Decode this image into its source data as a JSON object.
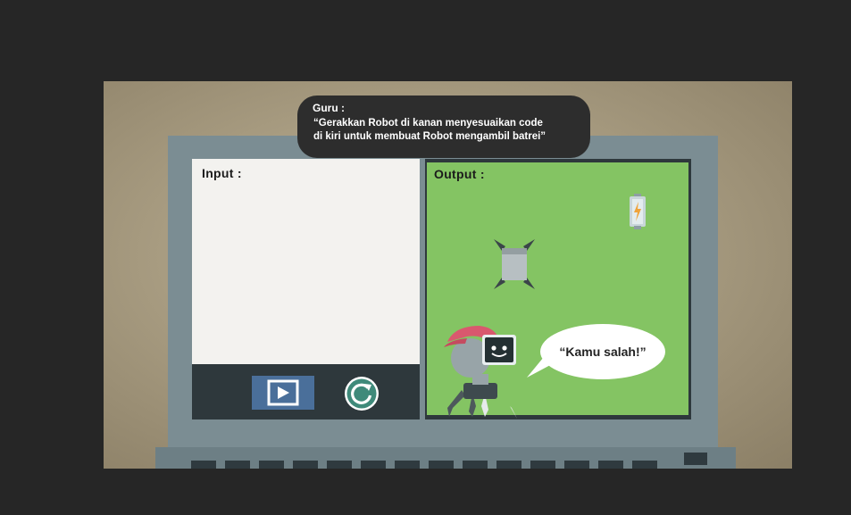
{
  "teacher": {
    "name": "Guru :",
    "line1": "“Gerakkan Robot di kanan menyesuaikan code",
    "line2": "di kiri untuk membuat Robot mengambil batrei”"
  },
  "input_panel": {
    "label": "Input :"
  },
  "output_panel": {
    "label": "Output :"
  },
  "controls": {
    "play_icon": "play-icon",
    "reset_icon": "reset-icon"
  },
  "robot": {
    "speech": "“Kamu salah!”"
  },
  "items": {
    "battery_icon": "battery-icon",
    "goal_icon": "goal-marker-icon"
  },
  "colors": {
    "output_bg": "#84c463",
    "input_bg": "#f3f2ef",
    "control_bar": "#2e383c",
    "play_button": "#4a6f9a",
    "reset_button": "#3f8a7a",
    "robot_cap": "#d9586e",
    "laptop": "#7b8d93"
  }
}
